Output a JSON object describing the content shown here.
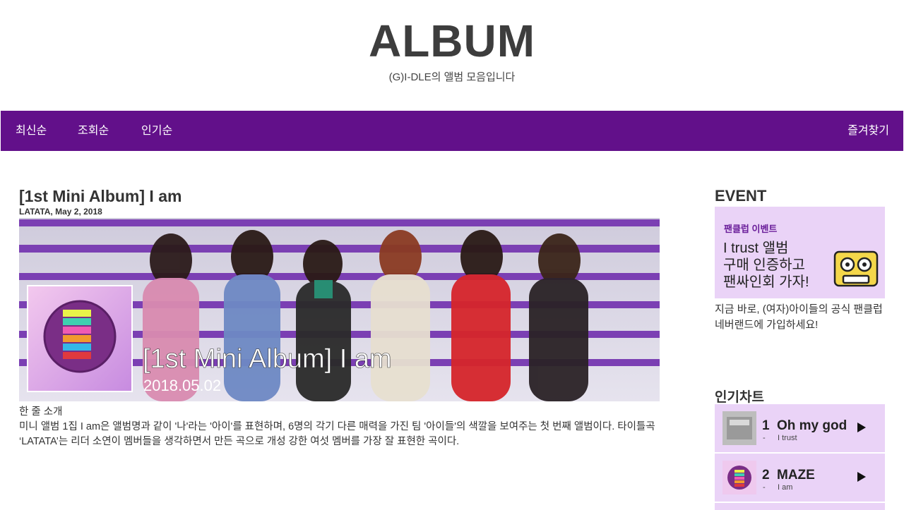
{
  "header": {
    "title": "ALBUM",
    "subtitle": "(G)I-DLE의 앨범 모음입니다"
  },
  "nav": {
    "items": [
      "최신순",
      "조회순",
      "인기순"
    ],
    "favorite": "즐겨찾기"
  },
  "post": {
    "title": "[1st Mini Album] I am",
    "meta": "LATATA, May 2, 2018",
    "banner": {
      "title": "[1st Mini Album] I am",
      "date": "2018.05.02"
    },
    "intro_heading": "한 줄 소개",
    "intro_text": "미니 앨범 1집 I am은 앨범명과 같이 '나'라는 '아이'를 표현하며, 6명의 각기 다른 매력을 가진 팀 '아이들'의 색깔을 보여주는 첫 번째 앨범이다. 타이틀곡 ‘LATATA’는 리더 소연이 멤버들을 생각하면서 만든 곡으로 개성 강한 여섯 멤버를 가장 잘 표현한 곡이다."
  },
  "sidebar": {
    "event_heading": "EVENT",
    "event_card": {
      "tag": "팬클럽 이벤트",
      "lines": [
        "I trust 앨범",
        "구매 인증하고",
        "팬싸인회 가자!"
      ]
    },
    "event_desc": "지금 바로, (여자)아이들의 공식 팬클럽 네버랜드에 가입하세요!",
    "chart_heading": "인기차트",
    "chart": [
      {
        "rank": "1",
        "title": "Oh my god",
        "dash": "-",
        "album": "I trust"
      },
      {
        "rank": "2",
        "title": "MAZE",
        "dash": "-",
        "album": "I am"
      }
    ]
  },
  "colors": {
    "nav_bg": "#62108a",
    "card_bg": "#ead3f7",
    "event_tag": "#6a1e9a"
  },
  "icons": {
    "event": "cassette-tape-icon",
    "play": "play-icon"
  }
}
